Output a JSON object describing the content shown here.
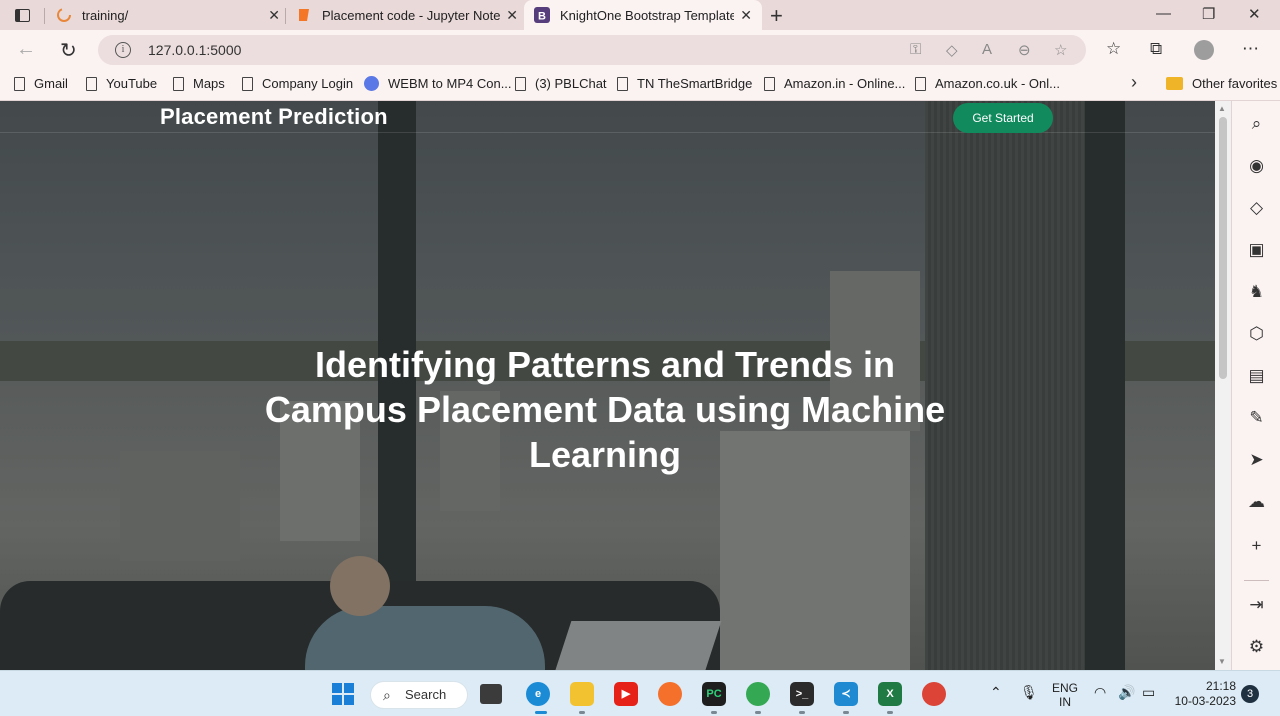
{
  "browser": {
    "tabs": [
      {
        "title": "training/",
        "favicon": "loading-spinner-icon"
      },
      {
        "title": "Placement code - Jupyter Notebook",
        "favicon": "jupyter-icon"
      },
      {
        "title": "KnightOne Bootstrap Template -",
        "favicon": "bootstrap-icon"
      }
    ],
    "url": "127.0.0.1:5000",
    "bookmarks": [
      "Gmail",
      "YouTube",
      "Maps",
      "Company Login",
      "WEBM to MP4 Con...",
      "(3) PBLChat",
      "TN TheSmartBridge",
      "Amazon.in - Online...",
      "Amazon.co.uk - Onl..."
    ],
    "other_favorites": "Other favorites"
  },
  "page": {
    "brand": "Placement Prediction",
    "cta_label": "Get Started",
    "hero_title": "Identifying Patterns and Trends in Campus Placement Data using Machine Learning"
  },
  "taskbar": {
    "search_label": "Search",
    "lang_line1": "ENG",
    "lang_line2": "IN",
    "time": "21:18",
    "date": "10-03-2023",
    "notification_count": "3"
  },
  "colors": {
    "cta": "#118a5e",
    "tab_strip": "#e9d9d9",
    "taskbar": "#dcebf5"
  }
}
